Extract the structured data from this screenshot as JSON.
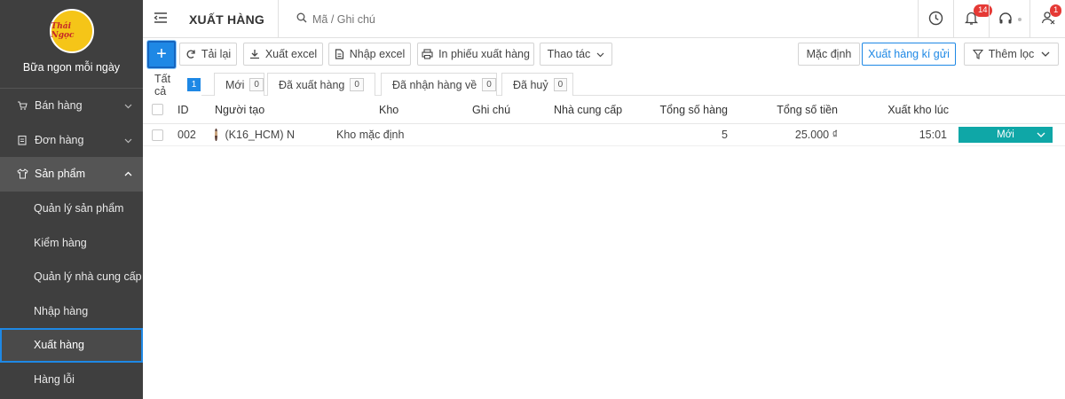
{
  "brand": {
    "name": "Bữa ngon mỗi ngày",
    "logo_text": "Thái Ngọc"
  },
  "sidebar": {
    "items": [
      {
        "label": "Bán hàng",
        "icon": "cart-icon"
      },
      {
        "label": "Đơn hàng",
        "icon": "clipboard-icon"
      },
      {
        "label": "Sản phẩm",
        "icon": "shirt-icon"
      }
    ],
    "sub_items": [
      {
        "label": "Quản lý sản phẩm"
      },
      {
        "label": "Kiểm hàng"
      },
      {
        "label": "Quản lý nhà cung cấp"
      },
      {
        "label": "Nhập hàng"
      },
      {
        "label": "Xuất hàng"
      },
      {
        "label": "Hàng lỗi"
      }
    ]
  },
  "header": {
    "title": "XUẤT HÀNG",
    "search_placeholder": "Mã / Ghi chú",
    "notification_count": "14",
    "user_badge": "1"
  },
  "toolbar": {
    "add_label": "+",
    "reload_label": "Tải lại",
    "export_excel_label": "Xuất excel",
    "import_excel_label": "Nhập excel",
    "print_label": "In phiếu xuất hàng",
    "actions_label": "Thao tác",
    "default_label": "Mặc định",
    "consignment_label": "Xuất hàng kí gửi",
    "filter_label": "Thêm lọc"
  },
  "tabs": [
    {
      "label": "Tất cả",
      "count": "1"
    },
    {
      "label": "Mới",
      "count": "0"
    },
    {
      "label": "Đã xuất hàng",
      "count": "0"
    },
    {
      "label": "Đã nhận hàng về",
      "count": "0"
    },
    {
      "label": "Đã huỷ",
      "count": "0"
    }
  ],
  "table": {
    "columns": [
      "ID",
      "Người tạo",
      "Kho",
      "Ghi chú",
      "Nhà cung cấp",
      "Tổng số hàng",
      "Tổng số tiền",
      "Xuất kho lúc"
    ],
    "rows": [
      {
        "id": "002",
        "creator": "(K16_HCM) N",
        "warehouse": "Kho mặc định",
        "note": "",
        "supplier": "",
        "total_items": "5",
        "total_amount": "25.000 ₫",
        "exported_at": "15:01",
        "status": "Mới"
      }
    ]
  },
  "colors": {
    "sidebar_bg": "#3f3f3f",
    "accent": "#1e88e5",
    "status_new": "#0fa7a7",
    "badge": "#e53935"
  }
}
